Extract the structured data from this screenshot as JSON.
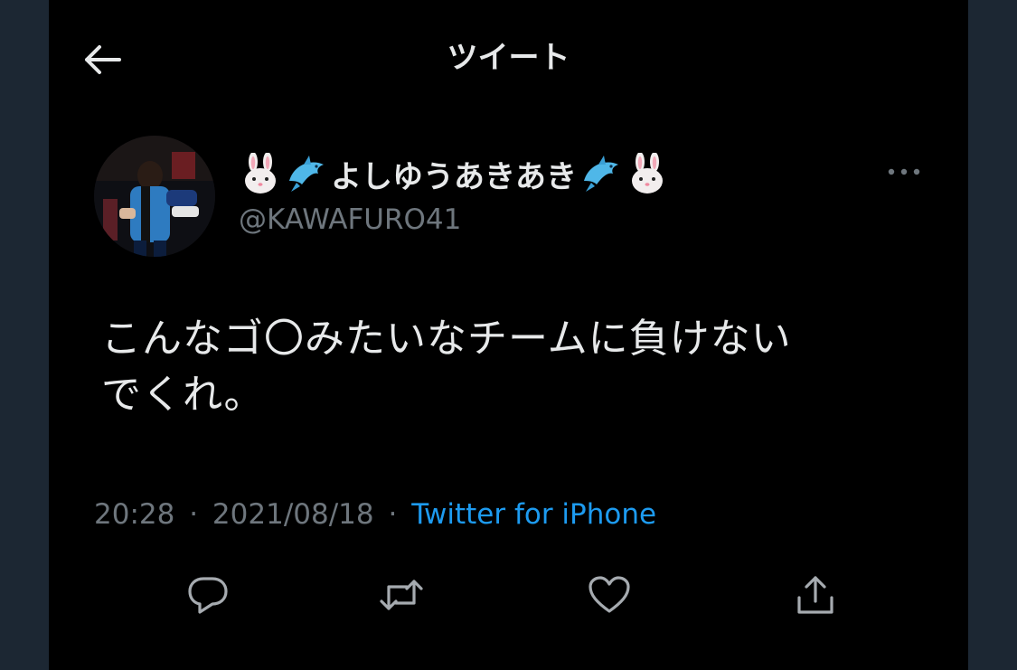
{
  "header": {
    "title": "ツイート",
    "back_icon": "arrow-left-icon"
  },
  "author": {
    "display_name_text": "よしゆうあきあき",
    "display_name_emoji_left": [
      "rabbit-face-emoji",
      "dolphin-emoji"
    ],
    "display_name_emoji_right": [
      "dolphin-emoji",
      "rabbit-face-emoji"
    ],
    "username": "@KAWAFURO41",
    "avatar": "profile-photo"
  },
  "more_icon": "more-horizontal-icon",
  "tweet": {
    "line1": "こんなゴ〇みたいなチームに負けない",
    "line2": "でくれ。"
  },
  "meta": {
    "time": "20:28",
    "separator": "·",
    "date": "2021/08/18",
    "source": "Twitter for iPhone"
  },
  "actions": [
    {
      "icon": "reply-icon"
    },
    {
      "icon": "retweet-icon"
    },
    {
      "icon": "like-icon"
    },
    {
      "icon": "share-icon"
    }
  ],
  "colors": {
    "background": "#000000",
    "outer": "#1c2733",
    "text": "#e7e9ea",
    "muted": "#6e767d",
    "link": "#1d9bf0"
  }
}
